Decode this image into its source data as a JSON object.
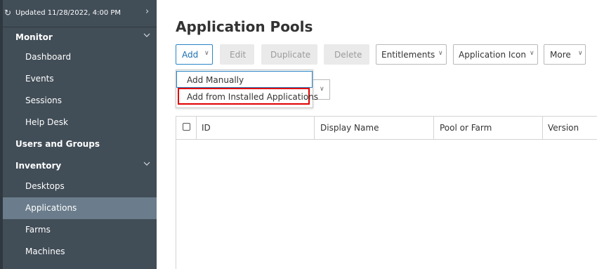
{
  "sidebar": {
    "updated_text": "Updated 11/28/2022, 4:00 PM",
    "refresh_icon": "refresh-icon",
    "expand_icon": "chevron-right-icon",
    "items": [
      {
        "label": "Monitor",
        "level": "top",
        "expanded": true
      },
      {
        "label": "Dashboard",
        "level": "sub"
      },
      {
        "label": "Events",
        "level": "sub"
      },
      {
        "label": "Sessions",
        "level": "sub"
      },
      {
        "label": "Help Desk",
        "level": "sub"
      },
      {
        "label": "Users and Groups",
        "level": "top"
      },
      {
        "label": "Inventory",
        "level": "top",
        "expanded": true
      },
      {
        "label": "Desktops",
        "level": "sub"
      },
      {
        "label": "Applications",
        "level": "sub",
        "active": true
      },
      {
        "label": "Farms",
        "level": "sub"
      },
      {
        "label": "Machines",
        "level": "sub"
      }
    ]
  },
  "page": {
    "title": "Application Pools"
  },
  "toolbar": {
    "add": "Add",
    "edit": "Edit",
    "duplicate": "Duplicate",
    "delete": "Delete",
    "entitlements": "Entitlements",
    "application_icon": "Application Icon",
    "more": "More"
  },
  "add_menu": {
    "items": [
      "Add Manually",
      "Add from Installed Applications"
    ]
  },
  "grid": {
    "columns": [
      "ID",
      "Display Name",
      "Pool or Farm",
      "Version"
    ]
  },
  "colors": {
    "sidebar_bg": "#414d57",
    "sidebar_active": "#6b7d8c",
    "accent": "#2a86c7",
    "highlight": "#e00000"
  }
}
